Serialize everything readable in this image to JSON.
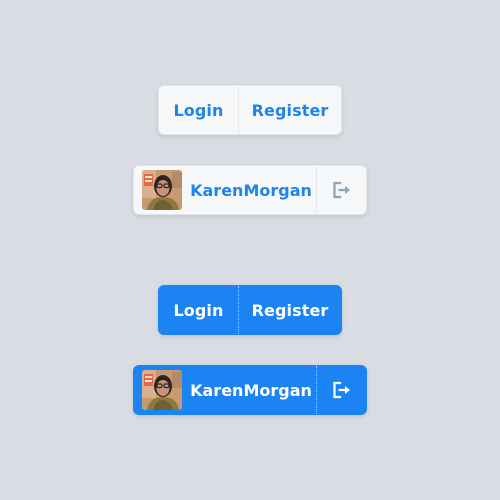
{
  "colors": {
    "background": "#d9dde3",
    "light_button_bg": "#f5f7f9",
    "light_text": "#1e86e8",
    "blue_button_bg": "#1c84f2",
    "blue_text": "#ffffff",
    "logout_icon_light": "#8ea2b8"
  },
  "light": {
    "auth": {
      "login_label": "Login",
      "register_label": "Register"
    },
    "user": {
      "username": "KarenMorgan",
      "avatar_icon": "user-avatar-photo",
      "logout_icon": "sign-out-icon"
    }
  },
  "blue": {
    "auth": {
      "login_label": "Login",
      "register_label": "Register"
    },
    "user": {
      "username": "KarenMorgan",
      "avatar_icon": "user-avatar-photo",
      "logout_icon": "sign-out-icon"
    }
  }
}
